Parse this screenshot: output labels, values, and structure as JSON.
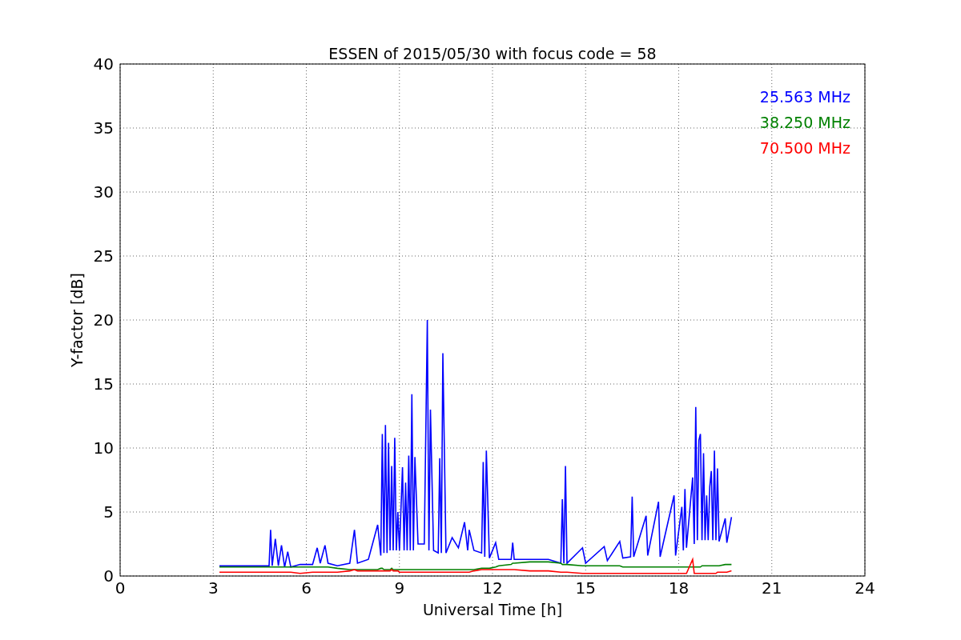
{
  "figure": {
    "chart_data": {
      "type": "line",
      "title": "ESSEN of 2015/05/30 with focus code = 58",
      "xlabel": "Universal Time [h]",
      "ylabel": "Y-factor [dB]",
      "xlim": [
        0,
        24
      ],
      "ylim": [
        0,
        40
      ],
      "xticks": [
        0,
        3,
        6,
        9,
        12,
        15,
        18,
        21,
        24
      ],
      "yticks": [
        0,
        5,
        10,
        15,
        20,
        25,
        30,
        35,
        40
      ],
      "grid": true,
      "x": [
        3.2,
        3.6,
        4.0,
        4.4,
        4.8,
        4.85,
        4.9,
        5.0,
        5.1,
        5.2,
        5.3,
        5.4,
        5.5,
        5.8,
        6.2,
        6.35,
        6.45,
        6.6,
        6.7,
        7.0,
        7.4,
        7.55,
        7.65,
        8.0,
        8.3,
        8.4,
        8.45,
        8.5,
        8.55,
        8.6,
        8.65,
        8.7,
        8.75,
        8.8,
        8.85,
        8.9,
        8.95,
        9.0,
        9.1,
        9.15,
        9.2,
        9.25,
        9.3,
        9.35,
        9.4,
        9.45,
        9.5,
        9.6,
        9.8,
        9.9,
        9.95,
        10.0,
        10.1,
        10.25,
        10.3,
        10.35,
        10.4,
        10.5,
        10.7,
        10.9,
        11.1,
        11.2,
        11.25,
        11.4,
        11.65,
        11.7,
        11.75,
        11.8,
        11.9,
        12.1,
        12.2,
        12.6,
        12.65,
        12.7,
        13.2,
        13.8,
        14.2,
        14.25,
        14.3,
        14.35,
        14.4,
        14.9,
        15.0,
        15.6,
        15.7,
        16.1,
        16.2,
        16.45,
        16.5,
        16.55,
        16.95,
        17.0,
        17.35,
        17.4,
        17.85,
        17.9,
        18.1,
        18.15,
        18.2,
        18.25,
        18.45,
        18.5,
        18.55,
        18.6,
        18.65,
        18.7,
        18.75,
        18.8,
        18.85,
        18.9,
        18.95,
        19.0,
        19.05,
        19.1,
        19.15,
        19.2,
        19.25,
        19.3,
        19.5,
        19.55,
        19.7
      ],
      "series": [
        {
          "name": "25.563 MHz",
          "color": "#0000ff",
          "values": [
            0.8,
            0.8,
            0.8,
            0.8,
            0.8,
            3.6,
            0.8,
            2.9,
            0.8,
            2.4,
            0.7,
            1.9,
            0.7,
            0.9,
            0.9,
            2.2,
            1.0,
            2.4,
            1.0,
            0.8,
            1.0,
            3.6,
            1.0,
            1.3,
            4.0,
            1.6,
            11.1,
            1.8,
            11.8,
            1.8,
            10.4,
            2.0,
            8.6,
            2.0,
            10.8,
            2.0,
            5.0,
            2.0,
            8.5,
            2.0,
            7.3,
            2.0,
            9.4,
            2.0,
            14.2,
            2.0,
            9.3,
            2.5,
            2.5,
            20.0,
            2.0,
            13.0,
            2.0,
            1.8,
            9.2,
            1.8,
            17.4,
            1.8,
            3.0,
            2.2,
            4.2,
            2.0,
            3.6,
            2.0,
            1.8,
            8.9,
            1.5,
            9.8,
            1.4,
            2.6,
            1.3,
            1.3,
            2.6,
            1.3,
            1.3,
            1.3,
            1.0,
            6.0,
            1.0,
            8.6,
            1.0,
            2.2,
            1.0,
            2.3,
            1.2,
            2.7,
            1.4,
            1.5,
            6.2,
            1.5,
            4.7,
            1.6,
            5.8,
            1.5,
            6.3,
            1.6,
            5.4,
            2.0,
            6.8,
            2.2,
            7.7,
            2.5,
            13.2,
            2.8,
            10.6,
            11.1,
            2.8,
            9.6,
            2.8,
            6.3,
            2.8,
            7.0,
            8.2,
            2.8,
            9.8,
            2.8,
            8.4,
            2.7,
            4.5,
            2.6,
            4.6
          ]
        },
        {
          "name": "38.250 MHz",
          "color": "#008000",
          "values": [
            0.7,
            0.7,
            0.7,
            0.7,
            0.7,
            0.7,
            0.7,
            0.7,
            0.7,
            0.7,
            0.7,
            0.7,
            0.7,
            0.7,
            0.7,
            0.7,
            0.7,
            0.7,
            0.7,
            0.6,
            0.5,
            0.5,
            0.5,
            0.5,
            0.5,
            0.6,
            0.6,
            0.5,
            0.5,
            0.5,
            0.5,
            0.5,
            0.6,
            0.5,
            0.5,
            0.5,
            0.5,
            0.5,
            0.5,
            0.5,
            0.5,
            0.5,
            0.5,
            0.5,
            0.5,
            0.5,
            0.5,
            0.5,
            0.5,
            0.5,
            0.5,
            0.5,
            0.5,
            0.5,
            0.5,
            0.5,
            0.5,
            0.5,
            0.5,
            0.5,
            0.5,
            0.5,
            0.5,
            0.5,
            0.6,
            0.6,
            0.6,
            0.6,
            0.6,
            0.7,
            0.8,
            0.9,
            1.0,
            1.0,
            1.1,
            1.1,
            1.0,
            0.9,
            0.9,
            0.9,
            0.9,
            0.8,
            0.8,
            0.8,
            0.8,
            0.8,
            0.7,
            0.7,
            0.7,
            0.7,
            0.7,
            0.7,
            0.7,
            0.7,
            0.7,
            0.7,
            0.7,
            0.7,
            0.7,
            0.7,
            0.7,
            0.7,
            0.7,
            0.7,
            0.7,
            0.7,
            0.8,
            0.8,
            0.8,
            0.8,
            0.8,
            0.8,
            0.8,
            0.8,
            0.8,
            0.8,
            0.8,
            0.8,
            0.9,
            0.9,
            0.9
          ]
        },
        {
          "name": "70.500 MHz",
          "color": "#ff0000",
          "values": [
            0.3,
            0.3,
            0.3,
            0.3,
            0.3,
            0.3,
            0.3,
            0.3,
            0.3,
            0.3,
            0.3,
            0.3,
            0.3,
            0.2,
            0.3,
            0.3,
            0.3,
            0.3,
            0.3,
            0.3,
            0.4,
            0.5,
            0.4,
            0.4,
            0.4,
            0.4,
            0.4,
            0.4,
            0.4,
            0.4,
            0.4,
            0.4,
            0.5,
            0.4,
            0.4,
            0.4,
            0.4,
            0.3,
            0.3,
            0.3,
            0.3,
            0.3,
            0.3,
            0.3,
            0.3,
            0.3,
            0.3,
            0.3,
            0.3,
            0.3,
            0.3,
            0.3,
            0.3,
            0.3,
            0.3,
            0.3,
            0.3,
            0.3,
            0.3,
            0.3,
            0.3,
            0.3,
            0.3,
            0.4,
            0.5,
            0.5,
            0.5,
            0.5,
            0.5,
            0.5,
            0.5,
            0.5,
            0.5,
            0.5,
            0.4,
            0.4,
            0.3,
            0.3,
            0.3,
            0.3,
            0.3,
            0.2,
            0.2,
            0.2,
            0.2,
            0.2,
            0.2,
            0.2,
            0.2,
            0.2,
            0.2,
            0.2,
            0.2,
            0.2,
            0.2,
            0.2,
            0.2,
            0.2,
            0.2,
            0.2,
            1.3,
            0.2,
            0.2,
            0.2,
            0.2,
            0.2,
            0.2,
            0.2,
            0.2,
            0.2,
            0.2,
            0.2,
            0.2,
            0.2,
            0.2,
            0.2,
            0.3,
            0.3,
            0.3,
            0.3,
            0.4
          ]
        }
      ]
    }
  }
}
